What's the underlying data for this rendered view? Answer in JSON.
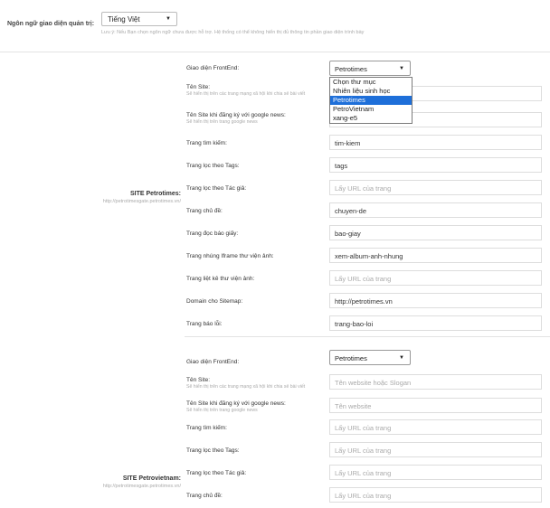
{
  "language": {
    "label": "Ngôn ngữ giao diện quản trị:",
    "selected": "Tiếng Việt",
    "note": "Lưu ý: Nếu Bạn chọn ngôn ngữ chưa được hỗ trợ. Hệ thống có thể không hiển thị đủ thông tin phần giao diện trình bày"
  },
  "sites": [
    {
      "title": "SITE Petrotimes:",
      "url": "http://petrotimesgate.petrotimes.vn/",
      "frontend": {
        "label": "Giao diện FrontEnd:",
        "selected": "Petrotimes",
        "options": [
          "Chọn thư mục",
          "Nhiên liệu sinh học",
          "Petrotimes",
          "PetroVietnam",
          "xang-e5"
        ]
      },
      "rows": [
        {
          "label": "Tên Site:",
          "hint": "Sẽ hiển thị trên các trang mạng xã hội khi chia sẻ bài viết",
          "value": "",
          "placeholder": ""
        },
        {
          "label": "Tên Site khi đăng ký với google news:",
          "hint": "Sẽ hiển thị trên trang google news",
          "value": "",
          "placeholder": ""
        },
        {
          "label": "Trang tìm kiếm:",
          "hint": "",
          "value": "tim-kiem",
          "placeholder": ""
        },
        {
          "label": "Trang lọc theo Tags:",
          "hint": "",
          "value": "tags",
          "placeholder": ""
        },
        {
          "label": "Trang lọc theo Tác giả:",
          "hint": "",
          "value": "",
          "placeholder": "Lấy URL của trang"
        },
        {
          "label": "Trang chủ đề:",
          "hint": "",
          "value": "chuyen-de",
          "placeholder": ""
        },
        {
          "label": "Trang đọc báo giấy:",
          "hint": "",
          "value": "bao-giay",
          "placeholder": ""
        },
        {
          "label": "Trang nhúng Iframe thư viện ảnh:",
          "hint": "",
          "value": "xem-album-anh-nhung",
          "placeholder": ""
        },
        {
          "label": "Trang liệt kê thư viện ảnh:",
          "hint": "",
          "value": "",
          "placeholder": "Lấy URL của trang"
        },
        {
          "label": "Domain cho Sitemap:",
          "hint": "",
          "value": "http://petrotimes.vn",
          "placeholder": ""
        },
        {
          "label": "Trang báo lỗi:",
          "hint": "",
          "value": "trang-bao-loi",
          "placeholder": ""
        }
      ]
    },
    {
      "title": "SITE Petrovietnam:",
      "url": "http://petrotimesgate.petrotimes.vn/",
      "frontend": {
        "label": "Giao diện FrontEnd:",
        "selected": "Petrotimes"
      },
      "rows": [
        {
          "label": "Tên Site:",
          "hint": "Sẽ hiển thị trên các trang mạng xã hội khi chia sẻ bài viết",
          "value": "",
          "placeholder": "Tên website hoặc Slogan"
        },
        {
          "label": "Tên Site khi đăng ký với google news:",
          "hint": "Sẽ hiển thị trên trang google news",
          "value": "",
          "placeholder": "Tên website"
        },
        {
          "label": "Trang tìm kiếm:",
          "hint": "",
          "value": "",
          "placeholder": "Lấy URL của trang"
        },
        {
          "label": "Trang lọc theo Tags:",
          "hint": "",
          "value": "",
          "placeholder": "Lấy URL của trang"
        },
        {
          "label": "Trang lọc theo Tác giả:",
          "hint": "",
          "value": "",
          "placeholder": "Lấy URL của trang"
        },
        {
          "label": "Trang chủ đề:",
          "hint": "",
          "value": "",
          "placeholder": "Lấy URL của trang"
        }
      ]
    }
  ]
}
